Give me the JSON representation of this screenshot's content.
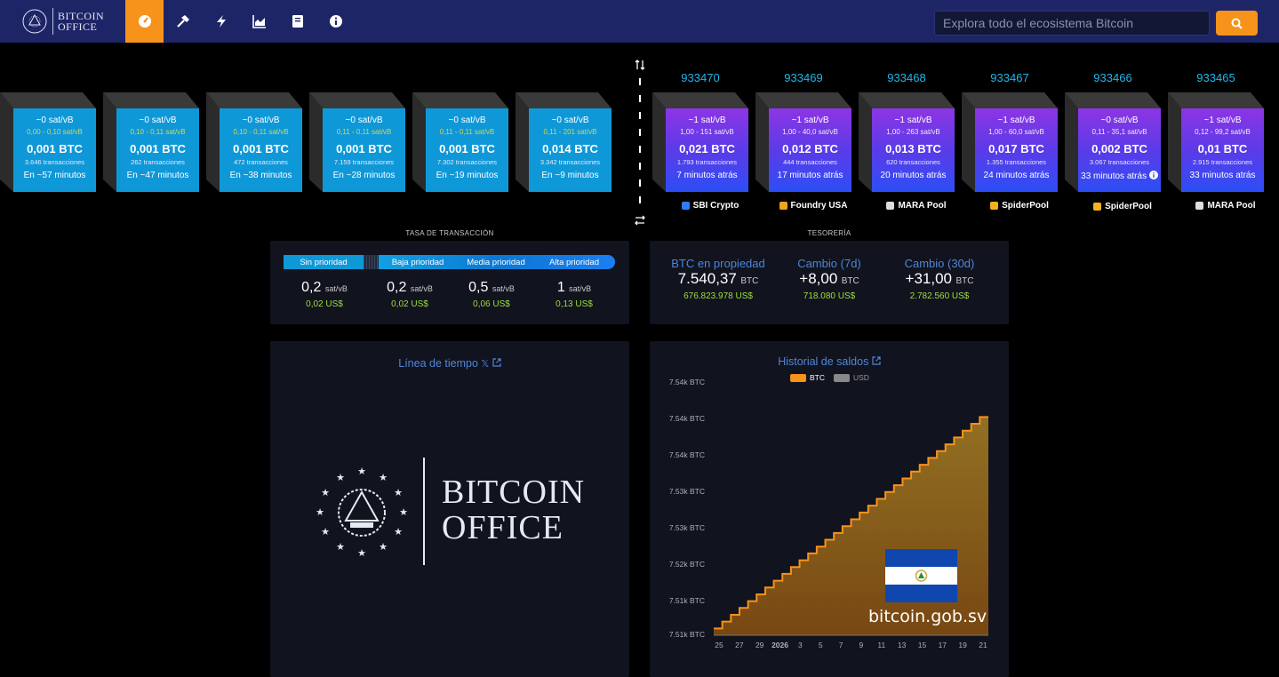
{
  "nav": {
    "logo_line1": "BITCOIN",
    "logo_line2": "OFFICE",
    "search_placeholder": "Explora todo el ecosistema Bitcoin",
    "items": [
      {
        "icon": "dashboard-icon",
        "active": true
      },
      {
        "icon": "hammer-icon",
        "active": false
      },
      {
        "icon": "lightning-icon",
        "active": false
      },
      {
        "icon": "chart-icon",
        "active": false
      },
      {
        "icon": "book-icon",
        "active": false
      },
      {
        "icon": "info-icon",
        "active": false
      }
    ]
  },
  "mempool_blocks": [
    {
      "fee": "~0 sat/vB",
      "range": "0,00 - 0,10 sat/vB",
      "total": "0,001 BTC",
      "txs": "3.646 transacciones",
      "eta": "En ~57 minutos"
    },
    {
      "fee": "~0 sat/vB",
      "range": "0,10 - 0,11 sat/vB",
      "total": "0,001 BTC",
      "txs": "262 transacciones",
      "eta": "En ~47 minutos"
    },
    {
      "fee": "~0 sat/vB",
      "range": "0,10 - 0,11 sat/vB",
      "total": "0,001 BTC",
      "txs": "472 transacciones",
      "eta": "En ~38 minutos"
    },
    {
      "fee": "~0 sat/vB",
      "range": "0,11 - 0,11 sat/vB",
      "total": "0,001 BTC",
      "txs": "7.159 transacciones",
      "eta": "En ~28 minutos"
    },
    {
      "fee": "~0 sat/vB",
      "range": "0,11 - 0,11 sat/vB",
      "total": "0,001 BTC",
      "txs": "7.302 transacciones",
      "eta": "En ~19 minutos"
    },
    {
      "fee": "~0 sat/vB",
      "range": "0,11 - 201 sat/vB",
      "total": "0,014 BTC",
      "txs": "3.342 transacciones",
      "eta": "En ~9 minutos"
    }
  ],
  "mined_blocks": [
    {
      "height": "933470",
      "fee": "~1 sat/vB",
      "range": "1,00 - 151 sat/vB",
      "total": "0,021 BTC",
      "txs": "1.793 transacciones",
      "age": "7 minutos atrás",
      "pool": "SBI Crypto",
      "pool_color": "#2f7cf6"
    },
    {
      "height": "933469",
      "fee": "~1 sat/vB",
      "range": "1,00 - 40,0 sat/vB",
      "total": "0,012 BTC",
      "txs": "444 transacciones",
      "age": "17 minutos atrás",
      "pool": "Foundry USA",
      "pool_color": "#f0a321"
    },
    {
      "height": "933468",
      "fee": "~1 sat/vB",
      "range": "1,00 - 263 sat/vB",
      "total": "0,013 BTC",
      "txs": "620 transacciones",
      "age": "20 minutos atrás",
      "pool": "MARA Pool",
      "pool_color": "#dddddd"
    },
    {
      "height": "933467",
      "fee": "~1 sat/vB",
      "range": "1,00 - 60,0 sat/vB",
      "total": "0,017 BTC",
      "txs": "1.355 transacciones",
      "age": "24 minutos atrás",
      "pool": "SpiderPool",
      "pool_color": "#f2b31d"
    },
    {
      "height": "933466",
      "fee": "~0 sat/vB",
      "range": "0,11 - 35,1 sat/vB",
      "total": "0,002 BTC",
      "txs": "3.067 transacciones",
      "age": "33 minutos atrás",
      "pool": "SpiderPool",
      "pool_color": "#f2b31d"
    },
    {
      "height": "933465",
      "fee": "~1 sat/vB",
      "range": "0,12 - 99,2 sat/vB",
      "total": "0,01 BTC",
      "txs": "2.915 transacciones",
      "age": "33 minutos atrás",
      "pool": "MARA Pool",
      "pool_color": "#dddddd"
    }
  ],
  "fees": {
    "section_title": "TASA DE TRANSACCIÓN",
    "tabs": [
      "Sin prioridad",
      "Baja prioridad",
      "Media prioridad",
      "Alta prioridad"
    ],
    "items": [
      {
        "value": "0,2",
        "unit": "sat/vB",
        "usd": "0,02 US$"
      },
      {
        "value": "0,2",
        "unit": "sat/vB",
        "usd": "0,02 US$"
      },
      {
        "value": "0,5",
        "unit": "sat/vB",
        "usd": "0,06 US$"
      },
      {
        "value": "1",
        "unit": "sat/vB",
        "usd": "0,13 US$"
      }
    ]
  },
  "treasury": {
    "section_title": "TESORERÍA",
    "items": [
      {
        "label": "BTC en propiedad",
        "value": "7.540,37",
        "unit": "BTC",
        "usd": "676.823.978 US$"
      },
      {
        "label": "Cambio (7d)",
        "value": "+8,00",
        "unit": "BTC",
        "usd": "718.080 US$"
      },
      {
        "label": "Cambio (30d)",
        "value": "+31,00",
        "unit": "BTC",
        "usd": "2.782.560 US$"
      }
    ]
  },
  "timeline": {
    "title": "Línea de tiempo",
    "x_icon": "𝕏",
    "logo_line1": "BITCOIN",
    "logo_line2": "OFFICE"
  },
  "history": {
    "title": "Historial de saldos",
    "legend": [
      "BTC",
      "USD"
    ],
    "watermark": "bitcoin.gob.sv",
    "colors": {
      "btc": "#f7931a",
      "usd": "#888888"
    }
  },
  "chart_data": {
    "type": "area",
    "title": "Historial de saldos",
    "y_tick_labels": [
      "7.54k BTC",
      "7.54k BTC",
      "7.54k BTC",
      "7.53k BTC",
      "7.53k BTC",
      "7.52k BTC",
      "7.51k BTC",
      "7.51k BTC"
    ],
    "x_tick_labels": [
      "25",
      "27",
      "29",
      "2026",
      "3",
      "5",
      "7",
      "9",
      "11",
      "13",
      "15",
      "17",
      "19",
      "21"
    ],
    "ylim": [
      7508,
      7545
    ],
    "series": [
      {
        "name": "BTC",
        "values": [
          7509,
          7510,
          7511,
          7512,
          7513,
          7514,
          7515,
          7516,
          7517,
          7518,
          7519,
          7520,
          7521,
          7522,
          7523,
          7524,
          7525,
          7526,
          7527,
          7528,
          7529,
          7530,
          7531,
          7532,
          7533,
          7534,
          7535,
          7536,
          7537,
          7538,
          7539,
          7540
        ]
      }
    ]
  }
}
